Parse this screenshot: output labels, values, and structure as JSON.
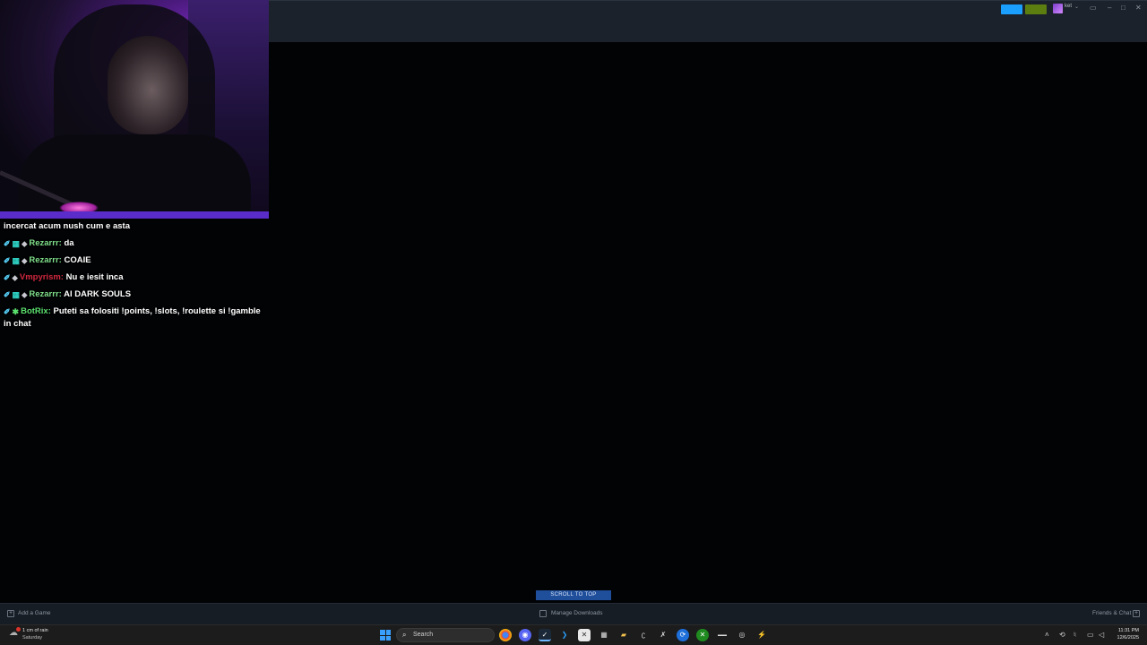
{
  "steam": {
    "user_name": "ket",
    "scroll_to_top": "SCROLL TO TOP",
    "add_game": "Add a Game",
    "manage_downloads": "Manage Downloads",
    "friends_chat": "Friends & Chat"
  },
  "chat": {
    "partial_top": "incercat acum nush cum e asta",
    "messages": [
      {
        "user": "Rezarrr",
        "user_color": "#7fe08a",
        "text": "da",
        "badges": [
          "sword-icon",
          "subscriber-badge-icon",
          "gem-icon"
        ]
      },
      {
        "user": "Rezarrr",
        "user_color": "#7fe08a",
        "text": "COAIE",
        "badges": [
          "sword-icon",
          "subscriber-badge-icon",
          "gem-icon"
        ]
      },
      {
        "user": "Vmpyrism",
        "user_color": "#d0283f",
        "text": "Nu e iesit inca",
        "badges": [
          "sword-icon",
          "gem-icon"
        ]
      },
      {
        "user": "Rezarrr",
        "user_color": "#7fe08a",
        "text": "AI DARK SOULS",
        "badges": [
          "sword-icon",
          "subscriber-badge-icon",
          "gem-icon"
        ]
      },
      {
        "user": "BotRix",
        "user_color": "#5be16e",
        "text": "Puteti sa folositi !points, !slots, !roulette si !gamble in chat",
        "badges": [
          "sword-icon",
          "bot-badge-icon"
        ]
      }
    ]
  },
  "taskbar": {
    "weather_line1": "1 cm of rain",
    "weather_line2": "Saturday",
    "search_label": "Search",
    "time": "11:31 PM",
    "date": "12/6/2025"
  },
  "colors": {
    "steam_accent": "#1a9fff",
    "notify_green": "#5c7e10",
    "scroll_top_bg": "#1f4e9b"
  }
}
